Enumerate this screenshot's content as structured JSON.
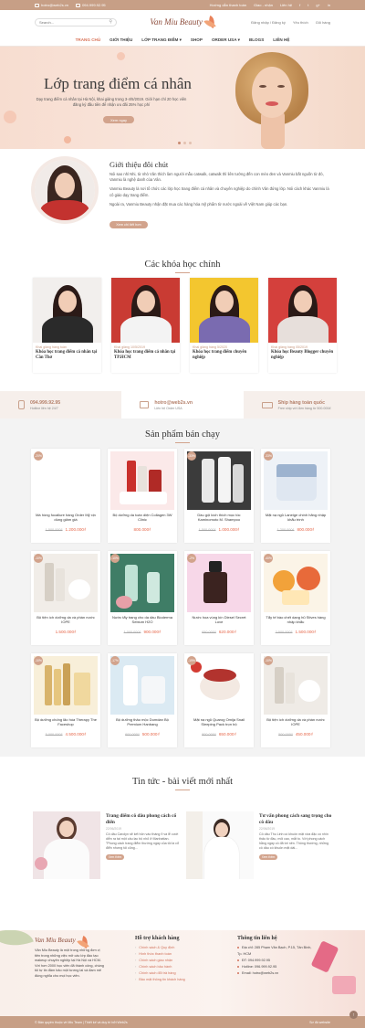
{
  "topbar": {
    "email": "hotro@web2s.vn",
    "phone": "094.999.92.95",
    "links": [
      "Hướng dẫn thanh toán",
      "Giao - nhận",
      "Liên hệ"
    ],
    "social": [
      "f",
      "t",
      "g+",
      "in"
    ]
  },
  "header": {
    "search_placeholder": "Search...",
    "logo_text": "Van Miu Beauty",
    "login": "Đăng nhập / Đăng ký",
    "wishlist": "Yêu thích",
    "cart": "Giỏ hàng"
  },
  "nav": [
    "TRANG CHỦ",
    "GIỚI THIỆU",
    "LỚP TRANG ĐIỂM ▾",
    "SHOP",
    "ORDER USA ▾",
    "BLOGS",
    "LIÊN HỆ"
  ],
  "hero": {
    "title": "Lớp trang điểm cá nhân",
    "text": "Dạy trang điểm cá nhân tại Hà Nội, khai giảng trong 3-4/5/2019. Giới hạn chỉ 20 học viên đăng ký đầu tiên để nhận ưu đãi 25% học phí",
    "button": "Xem ngay"
  },
  "intro": {
    "title": "Giới thiệu đôi chút",
    "paragraphs": [
      "Nói sao nhỉ Nhi, từ nhỏ Vân thích làm người mẫu catwalk, catwalk thì liên tưởng đến con mèo đen và Vanmiu bắt nguồn từ đó, Vanmiu là nghệ danh của Vân.",
      "Vanmiu Beauty là nơi tổ chức các lớp học trang điểm cá nhân và chuyên nghiệp do chính Vân đứng lớp. Nói cách khác Vanmiu là cô giáo dạy trang điểm.",
      "Ngoài ra, Vanmiu Beauty nhận đặt mua các hàng hóa mỹ phẩm từ nước ngoài về Việt Nam giúp các bạn."
    ],
    "button": "Xem chi tiết hơn"
  },
  "courses": {
    "title": "Các khóa học chính",
    "items": [
      {
        "date": "Khai giảng hàng tuần",
        "name": "Khóa học trang điểm cá nhân tại Cần Thơ"
      },
      {
        "date": "Khai giảng 10/5/2019",
        "name": "Khóa học trang điểm cá nhân tại TP.HCM"
      },
      {
        "date": "Khai giảng hàng 5/2020",
        "name": "Khóa học trang điểm chuyên nghiệp"
      },
      {
        "date": "Khai giảng hàng 05/2019",
        "name": "Khóa học Beauty Blogger chuyên nghiệp"
      }
    ]
  },
  "features": [
    {
      "title": "094.999.92.95",
      "sub": "Hotline liên hệ 24/7"
    },
    {
      "title": "hotro@web2s.vn",
      "sub": "Liên hệ Order USA"
    },
    {
      "title": "Ship hàng toàn quốc",
      "sub": "Free ship với đơn hàng từ 500.000đ"
    }
  ],
  "products": {
    "title": "Sản phẩm bán chạy",
    "items": [
      {
        "badge": "-20%",
        "name": "Má hồng focallure hàng Order Mỹ xịn dùng giảm giá",
        "old": "1.500.000₫",
        "new": "1.200.000₫"
      },
      {
        "badge": "",
        "name": "Bộ dưỡng da toàn diện Collagen 3W Clinic",
        "old": "",
        "new": "800.000₫"
      },
      {
        "badge": "-33%",
        "name": "Dầu gội kích thích mọc tóc Kaminomoto M. Shampoo",
        "old": "1.500.000₫",
        "new": "1.000.000₫"
      },
      {
        "badge": "-33%",
        "name": "Mặt nạ ngủ Laneige chính hãng nhập khẩu trình",
        "old": "1.200.000₫",
        "new": "800.000₫"
      },
      {
        "badge": "-10%",
        "name": "Bộ tiện ích dưỡng da và phần nước IOPE",
        "old": "",
        "new": "1.500.000₫"
      },
      {
        "badge": "-10%",
        "name": "Nước tẩy trang cho da dầu Bioderma Sebium H2O",
        "old": "1.000.000₫",
        "new": "900.000₫"
      },
      {
        "badge": "-2%",
        "name": "Nước hoa vùng kín Diesel Secret Love",
        "old": "650.000₫",
        "new": "620.000₫"
      },
      {
        "badge": "-40%",
        "name": "Tẩy tế bào chết dạng hũ Stives hàng nhập khẩu",
        "old": "2.500.000₫",
        "new": "1.500.000₫"
      },
      {
        "badge": "-10%",
        "name": "Bộ dưỡng chống lão hóa Therapy The Faceshop",
        "old": "5.000.000₫",
        "new": "4.500.000₫"
      },
      {
        "badge": "-17%",
        "name": "Bộ dưỡng thảo mộc Dumdan Bộ Premium Hanbang",
        "old": "600.000₫",
        "new": "500.000₫"
      },
      {
        "badge": "-19%",
        "name": "Mặt nạ ngủ Quarog Omija Snail Sleeping Pack trọn bộ",
        "old": "800.000₫",
        "new": "650.000₫"
      },
      {
        "badge": "-10%",
        "name": "Bộ tiện ích dưỡng da và phần nước IOPE",
        "old": "500.000₫",
        "new": "450.000₫"
      }
    ]
  },
  "news": {
    "title": "Tin tức - bài viết mới nhất",
    "items": [
      {
        "title": "Trang điểm cô dâu phong cách cổ điển",
        "date": "22/06/2019",
        "desc": "Cô dâu Carolyn sẽ kết hôn vào tháng 9 và lễ cưới diễn ra tại một câu lạc bộ nhỏ ở Manhattan. \"Phong cách trang điểm thường ngày của tôi là cổ điển nhưng tôi cũng...",
        "button": "Xem thêm"
      },
      {
        "title": "Tư vấn phong cách sang trọng cho cô dâu",
        "date": "22/06/2019",
        "desc": "Cô dâu Thu Linh có khuôn mặt vừa đặc có nhìn thấu từ đầu, môi cao, mắt to. Với phong cách hằng ngày cô đã tơi nên. Thông thường, những cô dâu có khuôn mặt dài...",
        "button": "Xem thêm"
      }
    ]
  },
  "footer": {
    "about": "Văn Miu Beauty là một trong những đơn vị tiên trong những việc mở các lớp đào tạo makeup chuyên nghiệp tại Hà Nội và HCM. Với hơn 2000 học viên đã thành công, chúng tôi tự tin đảm bảo một tương lai và đam mê đúng nghĩa cho mọi học viên.",
    "support_title": "Hỗ trợ khách hàng",
    "support_links": [
      "Chính sách & Quy định",
      "Hình thức thanh toán",
      "Chính sách giao nhận",
      "Chính sách bảo hành",
      "Chính sách đổi trả hàng",
      "Bảo mật thông tin khách hàng"
    ],
    "contact_title": "Thông tin liên hệ",
    "contact": [
      "Địa chỉ: 285 Phạm Văn Bạch, P.15, Tân Bình, Tp. HCM",
      "ĐT: 094.999.92.95",
      "Hotline: 096.999.92.95",
      "Email: hotro@web2s.vn"
    ],
    "copyright": "© Bản quyền thuộc về Miu Team | Thiết kế và duy trì bởi Web2s",
    "sitemap": "Sơ đồ website"
  },
  "colors": {
    "accent": "#c79f86",
    "price": "#e6674a",
    "link": "#d0705a"
  },
  "icons": [
    "email-icon",
    "phone-icon",
    "search-icon",
    "truck-icon",
    "arrow-up-icon"
  ]
}
